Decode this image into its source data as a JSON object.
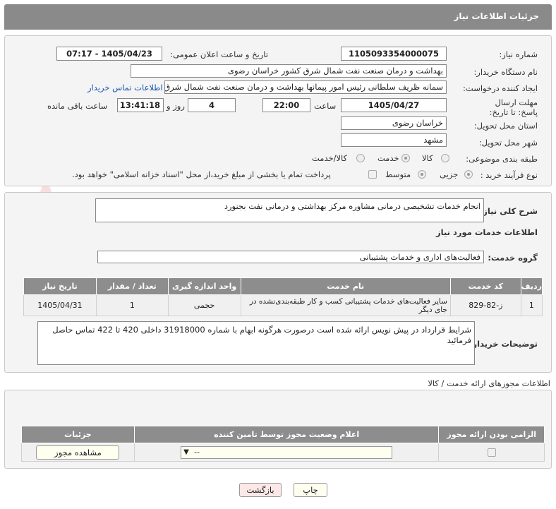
{
  "header": {
    "title": "جزئیات اطلاعات نیاز"
  },
  "form": {
    "need_number_label": "شماره نیاز:",
    "need_number": "1105093354000075",
    "announce_label": "تاریخ و ساعت اعلان عمومی:",
    "announce_value": "1405/04/23 - 07:17",
    "buyer_org_label": "نام دستگاه خریدار:",
    "buyer_org": "بهداشت و درمان صنعت نفت شمال شرق کشور   خراسان رضوی",
    "requester_label": "ایجاد کننده درخواست:",
    "requester": "سمانه ظریف سلطانی رئیس امور پیمانها بهداشت و درمان صنعت نفت شمال شرق",
    "buyer_contact_link": "اطلاعات تماس خریدار",
    "deadline_label": "مهلت ارسال پاسخ: تا تاریخ:",
    "deadline_date": "1405/04/27",
    "time_label": "ساعت",
    "deadline_time": "22:00",
    "days": "4",
    "days_label": "روز و",
    "remaining": "13:41:18",
    "remaining_label": "ساعت باقی مانده",
    "province_label": "استان محل تحویل:",
    "province": "خراسان رضوی",
    "city_label": "شهر محل تحویل:",
    "city": "مشهد",
    "category_label": "طبقه بندی موضوعی:",
    "category_options": [
      "کالا",
      "خدمت",
      "کالا/خدمت"
    ],
    "category_selected": "خدمت",
    "process_label": "نوع فرآیند خرید :",
    "process_options": [
      "جزیی",
      "متوسط"
    ],
    "process_selected": "جزیی",
    "payment_note": "پرداخت تمام یا بخشی از مبلغ خرید،از محل \"اسناد خزانه اسلامی\" خواهد بود."
  },
  "summary": {
    "label": "شرح کلی نیاز:",
    "value": "انجام خدمات تشخیصی درمانی مشاوره مرکز بهداشتی و درمانی نفت بجنورد"
  },
  "services": {
    "heading": "اطلاعات خدمات مورد نیاز",
    "group_label": "گروه خدمت:",
    "group_value": "فعالیت‌های اداری و خدمات پشتیبانی",
    "columns": [
      "ردیف",
      "کد خدمت",
      "نام خدمت",
      "واحد اندازه گیری",
      "تعداد / مقدار",
      "تاریخ نیاز"
    ],
    "rows": [
      [
        "1",
        "ز-82-829",
        "سایر فعالیت‌های خدمات پشتیبانی کسب و کار طبقه‌بندی‌نشده در جای دیگر",
        "حجمی",
        "1",
        "1405/04/31"
      ]
    ]
  },
  "buyer_notes": {
    "label": "توضیحات خریدار:",
    "value": "شرایط قرارداد در پیش نویس ارائه شده است درصورت هرگونه ابهام با شماره 31918000 داخلی 420 تا 422 تماس حاصل فرمائید"
  },
  "permits": {
    "heading": "اطلاعات مجوزهای ارائه خدمت / کالا",
    "columns": [
      "الزامی بودن ارائه مجوز",
      "اعلام وضعیت مجوز توسط تامین کننده",
      "جزئیات"
    ],
    "select_value": "--",
    "view_button": "مشاهده مجوز"
  },
  "footer": {
    "print_button": "چاپ",
    "back_button": "بازگشت"
  },
  "watermark": {
    "text": "AriaTender.net"
  }
}
